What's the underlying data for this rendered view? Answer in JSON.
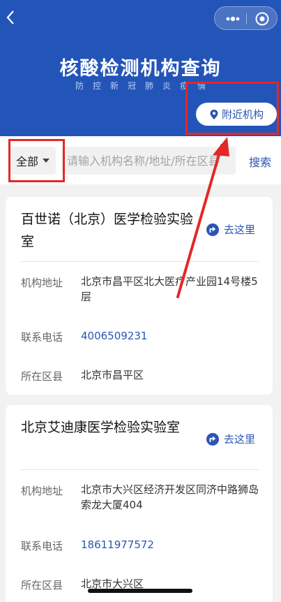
{
  "header": {
    "title": "核酸检测机构查询",
    "subtitle": "防控新冠肺炎疫情",
    "nearby_label": "附近机构"
  },
  "search": {
    "filter_label": "全部",
    "placeholder": "请输入机构名称/地址/所在区县",
    "button_label": "搜索"
  },
  "labels": {
    "address": "机构地址",
    "phone": "联系电话",
    "district": "所在区县",
    "goto": "去这里"
  },
  "institutions": [
    {
      "name": "百世诺（北京）医学检验实验室",
      "address": "北京市昌平区北大医疗产业园14号楼5层",
      "phone": "4006509231",
      "district": "北京市昌平区"
    },
    {
      "name": "北京艾迪康医学检验实验室",
      "address": "北京市大兴区经济开发区同济中路狮岛索龙大厦404",
      "phone": "18611977572",
      "district": "北京市大兴区"
    }
  ],
  "colors": {
    "header_bg": "#2355b8",
    "accent": "#2a56b5",
    "annotation_red": "#e52727"
  }
}
